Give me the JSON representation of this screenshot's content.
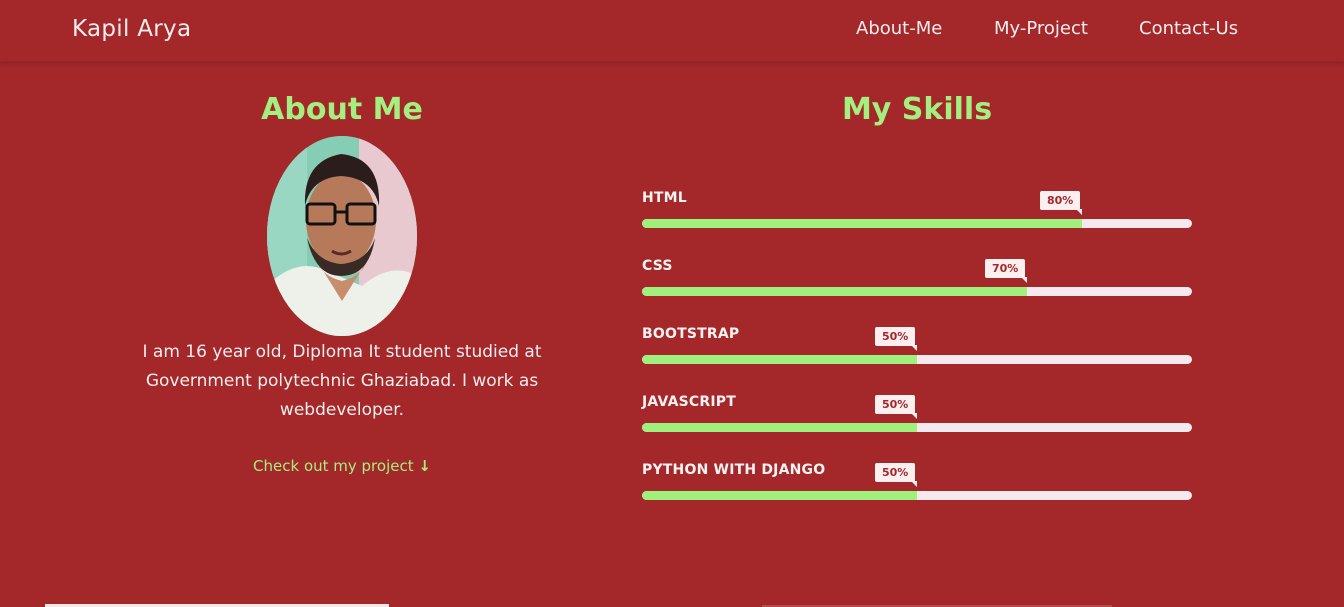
{
  "nav": {
    "brand": "Kapil Arya",
    "links": [
      "About-Me",
      "My-Project",
      "Contact-Us"
    ]
  },
  "about": {
    "title": "About Me",
    "description": "I am 16 year old, Diploma It student studied at Government polytechnic Ghaziabad. I work as webdeveloper.",
    "cta": "Check out my project",
    "cta_icon": "arrow-down-icon"
  },
  "skills": {
    "title": "My Skills",
    "items": [
      {
        "name": "HTML",
        "percent": 80,
        "label": "80%"
      },
      {
        "name": "CSS",
        "percent": 70,
        "label": "70%"
      },
      {
        "name": "BOOTSTRAP",
        "percent": 50,
        "label": "50%"
      },
      {
        "name": "JAVASCRIPT",
        "percent": 50,
        "label": "50%"
      },
      {
        "name": "PYTHON WITH DJANGO",
        "percent": 50,
        "label": "50%"
      }
    ]
  },
  "colors": {
    "background": "#a4272a",
    "accent_green": "#a3ef7f",
    "bar_fill": "#9ff07c",
    "bar_track": "#f4e9ee"
  }
}
